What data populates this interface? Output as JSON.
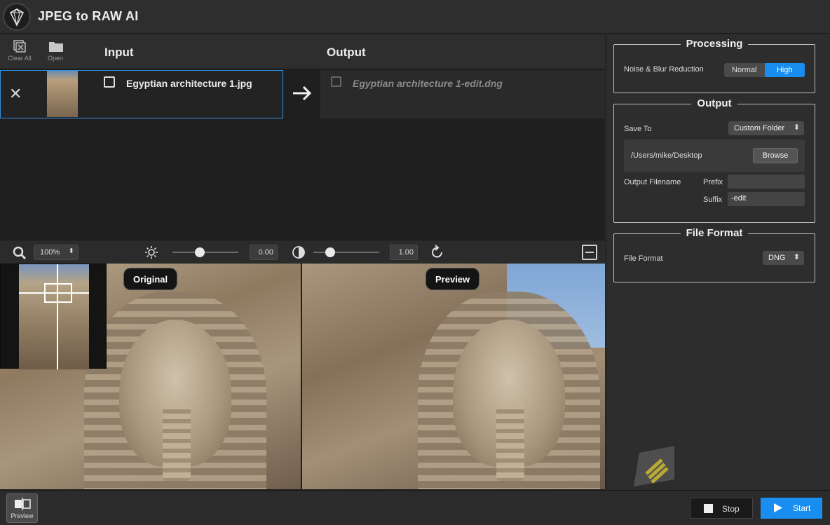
{
  "app": {
    "title": "JPEG to RAW AI"
  },
  "toolbar": {
    "clear_all": "Clear All",
    "open": "Open"
  },
  "io": {
    "input_heading": "Input",
    "output_heading": "Output",
    "input_file": "Egyptian architecture 1.jpg",
    "output_file": "Egyptian architecture 1-edit.dng"
  },
  "view_toolbar": {
    "zoom": "100%",
    "brightness_value": "0.00",
    "contrast_value": "1.00",
    "brightness_level": 0.42,
    "contrast_level": 0.26
  },
  "images": {
    "original_label": "Original",
    "preview_label": "Preview"
  },
  "sidebar": {
    "processing": {
      "title": "Processing",
      "noise_label": "Noise & Blur Reduction",
      "options": [
        "Normal",
        "High"
      ],
      "selected": "High"
    },
    "output": {
      "title": "Output",
      "save_to_label": "Save To",
      "save_to_value": "Custom Folder",
      "path": "/Users/mike/Desktop",
      "browse": "Browse",
      "filename_label": "Output Filename",
      "prefix_label": "Prefix",
      "prefix_value": "",
      "suffix_label": "Suffix",
      "suffix_value": "-edit"
    },
    "file_format": {
      "title": "File Format",
      "label": "File Format",
      "value": "DNG"
    }
  },
  "bottom": {
    "preview": "Preview",
    "stop": "Stop",
    "start": "Start"
  },
  "colors": {
    "accent": "#1a8ef0",
    "selection_border": "#2f8fe0"
  }
}
